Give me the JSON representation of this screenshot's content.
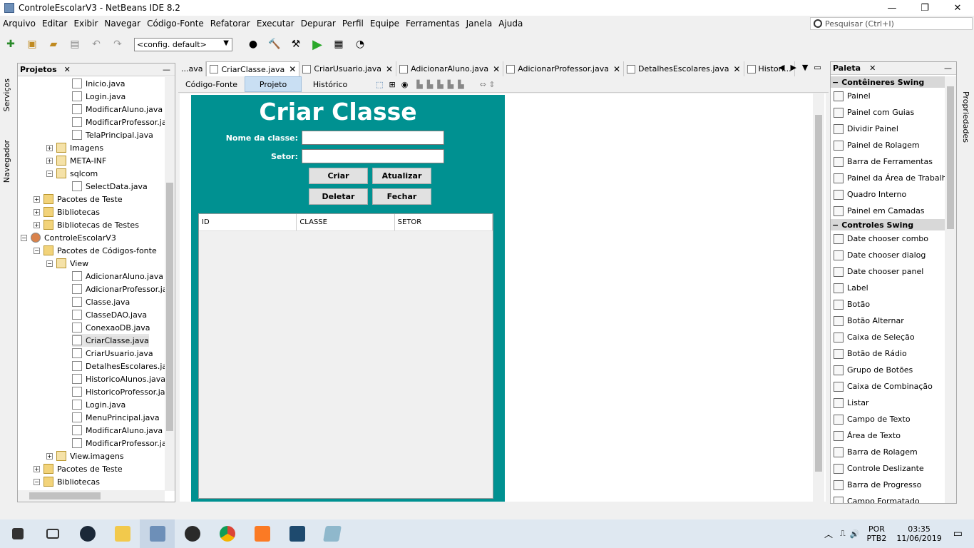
{
  "window": {
    "title": "ControleEscolarV3 - NetBeans IDE 8.2",
    "minimize": "—",
    "maximize": "❐",
    "close": "✕"
  },
  "menu": [
    "Arquivo",
    "Editar",
    "Exibir",
    "Navegar",
    "Código-Fonte",
    "Refatorar",
    "Executar",
    "Depurar",
    "Perfil",
    "Equipe",
    "Ferramentas",
    "Janela",
    "Ajuda"
  ],
  "search": {
    "placeholder": "Pesquisar (Ctrl+I)"
  },
  "toolbar": {
    "config": "<config. default>"
  },
  "left_strip": {
    "services": "Serviços",
    "navigator": "Navegador"
  },
  "projects": {
    "title": "Projetos",
    "tree": [
      {
        "label": "Inicio.java",
        "level": 4,
        "type": "file"
      },
      {
        "label": "Login.java",
        "level": 4,
        "type": "file"
      },
      {
        "label": "ModificarAluno.java",
        "level": 4,
        "type": "file"
      },
      {
        "label": "ModificarProfessor.jav",
        "level": 4,
        "type": "file"
      },
      {
        "label": "TelaPrincipal.java",
        "level": 4,
        "type": "file"
      },
      {
        "label": "Imagens",
        "level": 3,
        "type": "pkg",
        "exp": "+"
      },
      {
        "label": "META-INF",
        "level": 3,
        "type": "pkg",
        "exp": "+"
      },
      {
        "label": "sqlcom",
        "level": 3,
        "type": "pkg",
        "exp": "−"
      },
      {
        "label": "SelectData.java",
        "level": 4,
        "type": "file"
      },
      {
        "label": "Pacotes de Teste",
        "level": 2,
        "type": "fold",
        "exp": "+"
      },
      {
        "label": "Bibliotecas",
        "level": 2,
        "type": "fold",
        "exp": "+"
      },
      {
        "label": "Bibliotecas de Testes",
        "level": 2,
        "type": "fold",
        "exp": "+"
      },
      {
        "label": "ControleEscolarV3",
        "level": 1,
        "type": "proj",
        "exp": "−"
      },
      {
        "label": "Pacotes de Códigos-fonte",
        "level": 2,
        "type": "fold",
        "exp": "−"
      },
      {
        "label": "View",
        "level": 3,
        "type": "pkg",
        "exp": "−"
      },
      {
        "label": "AdicionarAluno.java",
        "level": 4,
        "type": "file"
      },
      {
        "label": "AdicionarProfessor.ja",
        "level": 4,
        "type": "file"
      },
      {
        "label": "Classe.java",
        "level": 4,
        "type": "file"
      },
      {
        "label": "ClasseDAO.java",
        "level": 4,
        "type": "file"
      },
      {
        "label": "ConexaoDB.java",
        "level": 4,
        "type": "file"
      },
      {
        "label": "CriarClasse.java",
        "level": 4,
        "type": "file",
        "selected": true
      },
      {
        "label": "CriarUsuario.java",
        "level": 4,
        "type": "file"
      },
      {
        "label": "DetalhesEscolares.jav",
        "level": 4,
        "type": "file"
      },
      {
        "label": "HistoricoAlunos.java",
        "level": 4,
        "type": "file"
      },
      {
        "label": "HistoricoProfessor.jav",
        "level": 4,
        "type": "file"
      },
      {
        "label": "Login.java",
        "level": 4,
        "type": "file"
      },
      {
        "label": "MenuPrincipal.java",
        "level": 4,
        "type": "file"
      },
      {
        "label": "ModificarAluno.java",
        "level": 4,
        "type": "file"
      },
      {
        "label": "ModificarProfessor.jav",
        "level": 4,
        "type": "file"
      },
      {
        "label": "View.imagens",
        "level": 3,
        "type": "pkg",
        "exp": "+"
      },
      {
        "label": "Pacotes de Teste",
        "level": 2,
        "type": "fold",
        "exp": "+"
      },
      {
        "label": "Bibliotecas",
        "level": 2,
        "type": "fold",
        "exp": "−"
      }
    ]
  },
  "editor_tabs": [
    {
      "label": "...ava"
    },
    {
      "label": "CriarClasse.java",
      "active": true
    },
    {
      "label": "CriarUsuario.java"
    },
    {
      "label": "AdicionarAluno.java"
    },
    {
      "label": "AdicionarProfessor.java"
    },
    {
      "label": "DetalhesEscolares.java"
    },
    {
      "label": "Histori..."
    }
  ],
  "editor_modes": {
    "source": "Código-Fonte",
    "design": "Projeto",
    "history": "Histórico"
  },
  "form": {
    "title": "Criar Classe",
    "name_label": "Nome da classe:",
    "sector_label": "Setor:",
    "create": "Criar",
    "update": "Atualizar",
    "delete": "Deletar",
    "close": "Fechar",
    "columns": [
      "ID",
      "CLASSE",
      "SETOR"
    ]
  },
  "palette": {
    "title": "Paleta",
    "properties": "Propriedades",
    "categories": [
      {
        "name": "Contêineres Swing",
        "items": [
          "Painel",
          "Painel com Guias",
          "Dividir Painel",
          "Painel de Rolagem",
          "Barra de Ferramentas",
          "Painel da Área de Trabalho",
          "Quadro Interno",
          "Painel em Camadas"
        ]
      },
      {
        "name": "Controles Swing",
        "items": [
          "Date chooser combo",
          "Date chooser dialog",
          "Date chooser panel",
          "Label",
          "Botão",
          "Botão Alternar",
          "Caixa de Seleção",
          "Botão de Rádio",
          "Grupo de Botões",
          "Caixa de Combinação",
          "Listar",
          "Campo de Texto",
          "Área de Texto",
          "Barra de Rolagem",
          "Controle Deslizante",
          "Barra de Progresso",
          "Campo Formatado"
        ]
      }
    ]
  },
  "taskbar": {
    "lang1": "POR",
    "lang2": "PTB2",
    "time": "03:35",
    "date": "11/06/2019"
  },
  "colors": {
    "form_bg": "#009191",
    "accent": "#c9dff3"
  }
}
